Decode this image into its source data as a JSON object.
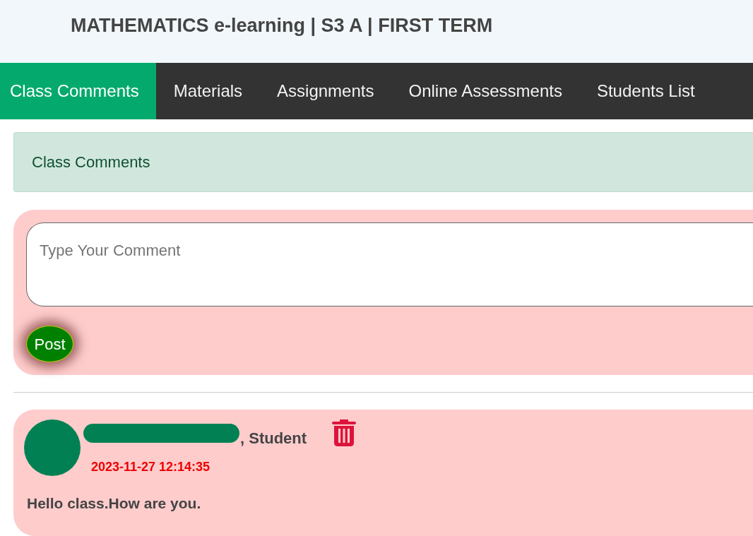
{
  "header": {
    "title": "MATHEMATICS e-learning | S3 A | FIRST TERM"
  },
  "tabs": [
    {
      "label": "Class Comments",
      "selected": true
    },
    {
      "label": "Materials",
      "selected": false
    },
    {
      "label": "Assignments",
      "selected": false
    },
    {
      "label": "Online Assessments",
      "selected": false
    },
    {
      "label": "Students List",
      "selected": false
    }
  ],
  "section_heading": "Class Comments",
  "comment_form": {
    "placeholder": "Type Your Comment",
    "button": "Post"
  },
  "comments": [
    {
      "author_redacted": true,
      "author_role": ", Student",
      "timestamp": "2023-11-27 12:14:35",
      "text": "Hello class.How are you."
    }
  ]
}
